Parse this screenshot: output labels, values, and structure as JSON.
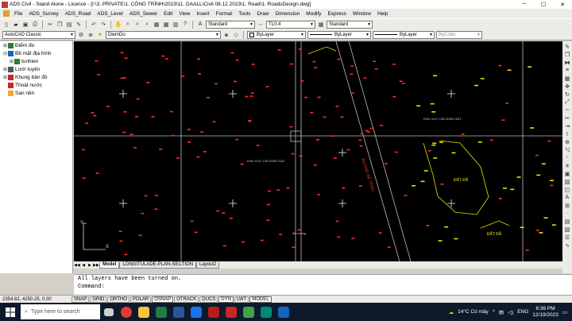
{
  "app": {
    "title": "ADS Civil - Stand Alone - Licence - [I:\\3. PRIVATE\\1. CÔNG TRÌNH\\2023\\11. DAALL\\Civil 08.12.2023\\1. Road\\1. RoadsDesign.dwg]"
  },
  "menu": [
    "File",
    "ADS_Survey",
    "ADS_Road",
    "ADS_Level",
    "ADS_Sewer",
    "Edit",
    "View",
    "Insert",
    "Format",
    "Tools",
    "Draw",
    "Dimension",
    "Modify",
    "Express",
    "Window",
    "Help"
  ],
  "toolbar": {
    "text_style": "Standard",
    "dim_style": "TL0.4",
    "table_style": "Standard",
    "workspace": "AutoCAD Classic",
    "layer": "DiemDo",
    "color": "ByLayer",
    "linetype": "ByLayer",
    "lineweight": "ByLayer",
    "plot_style": "ByColor"
  },
  "tree": [
    {
      "label": "Điểm đo",
      "expand": "⊞",
      "indent": 0,
      "color": "#2e7d32"
    },
    {
      "label": "Bề mặt địa hình",
      "expand": "⊟",
      "indent": 0,
      "color": "#1565c0"
    },
    {
      "label": "tunhien",
      "expand": "⊞",
      "indent": 1,
      "color": "#2e7d32"
    },
    {
      "label": "Lưới tuyến",
      "expand": "⊞",
      "indent": 0,
      "color": "#555555"
    },
    {
      "label": "Khung bản đồ",
      "expand": "⊞",
      "indent": 0,
      "color": "#c62828"
    },
    {
      "label": "Thoát nước",
      "expand": "",
      "indent": 0,
      "color": "#c62828"
    },
    {
      "label": "San nền",
      "expand": "",
      "indent": 0,
      "color": "#f9a825"
    }
  ],
  "drawing": {
    "area_label_left": "KHU VỰC CẢI KHẢO SÁT",
    "area_label_right": "KHU VỰC CẢI KHẢO SÁT",
    "road_label": "ĐƯỜNG BÊ TÔNG",
    "lot_label_1": "ĐẤT ĐẮ",
    "lot_label_2": "ĐẤT ĐẮ",
    "bottom_label": "đất ruộng",
    "axis_y": "Y",
    "axis_x": "X"
  },
  "tabs": {
    "model": "Model",
    "layout1": "LONGITULADE-PLAN-SECTION",
    "layout2": "Layout2"
  },
  "command": {
    "line1": "All layers have been turned on.",
    "line2": "Command:"
  },
  "status": {
    "coords": "2354.82, 4250.25, 0.00",
    "buttons": [
      "SNAP",
      "GRID",
      "ORTHO",
      "POLAR",
      "OSNAP",
      "OTRACK",
      "DUCS",
      "DYN",
      "LWT",
      "MODEL"
    ]
  },
  "taskbar": {
    "search_placeholder": "Type here to search",
    "weather": "14°C Có mây",
    "lang": "ENG",
    "time": "6:36 PM",
    "date": "12/19/2023"
  }
}
